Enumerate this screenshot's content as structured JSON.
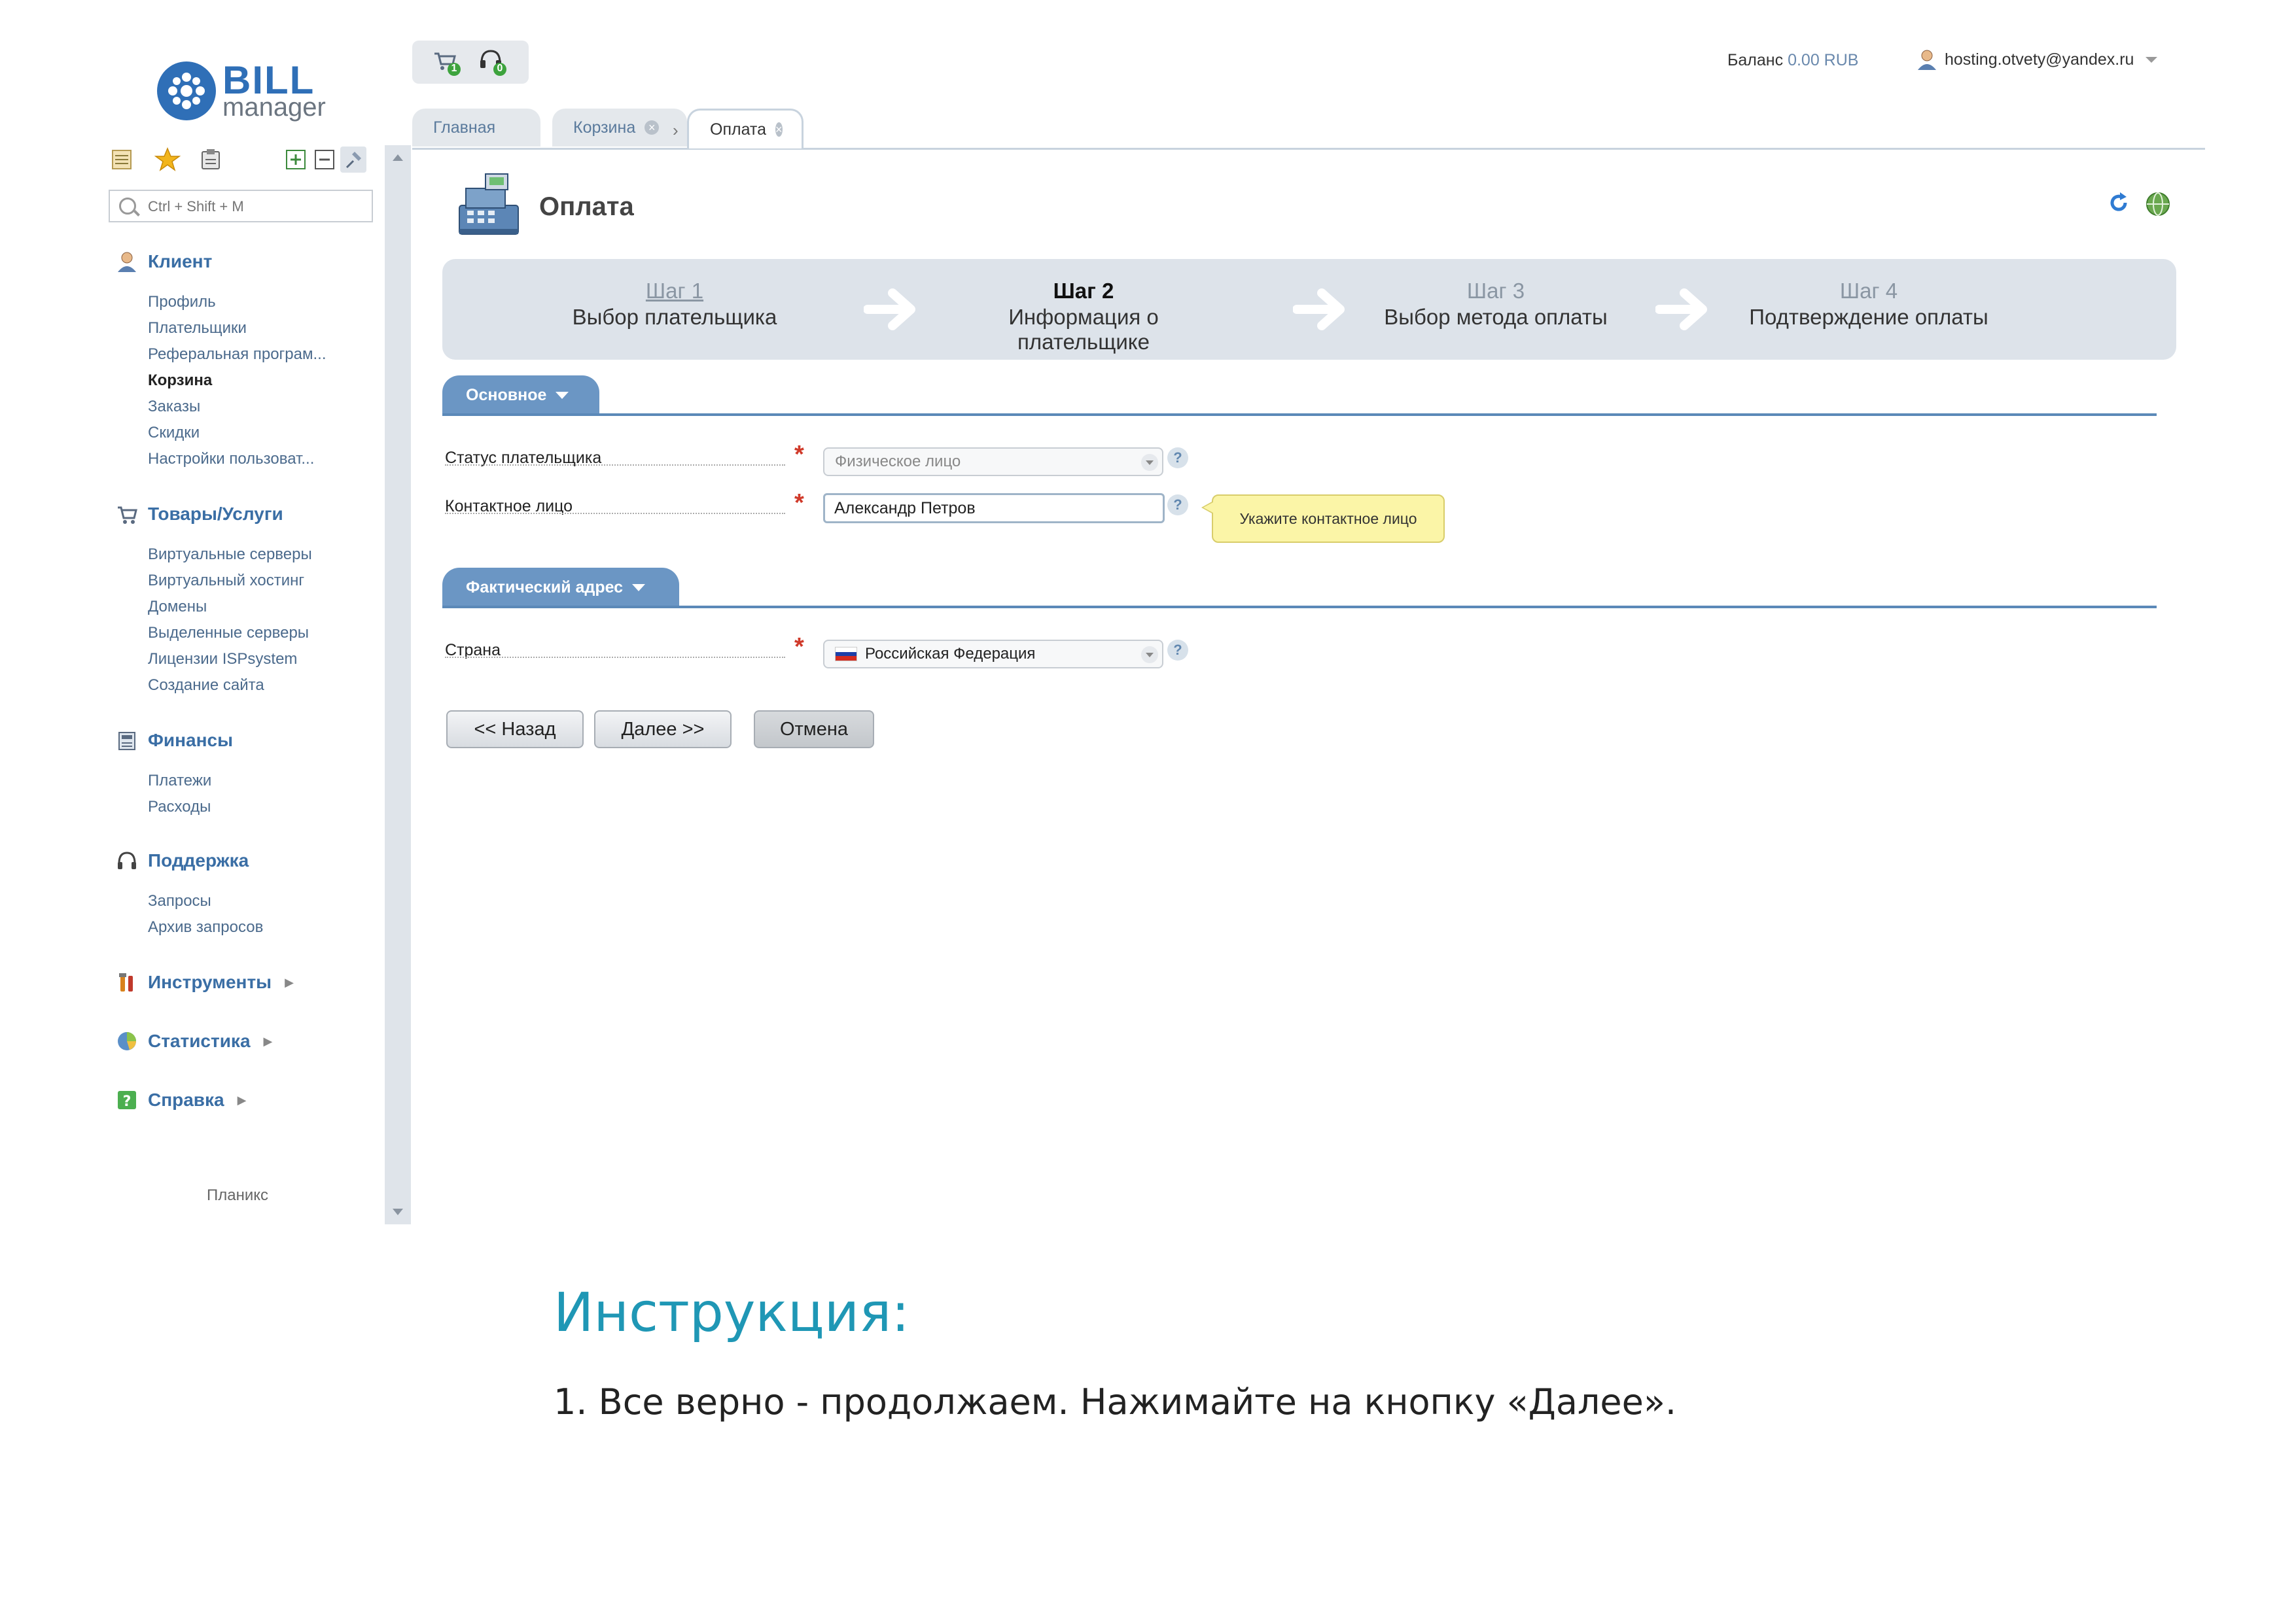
{
  "logo": {
    "word1": "BILL",
    "word2": "manager",
    "brand_color": "#2f6fb7"
  },
  "search": {
    "placeholder": "Ctrl + Shift + M"
  },
  "sidebar": {
    "groups": [
      {
        "title": "Клиент",
        "icon": "user-icon",
        "items": [
          {
            "label": "Профиль"
          },
          {
            "label": "Плательщики"
          },
          {
            "label": "Реферальная програм..."
          },
          {
            "label": "Корзина",
            "active": true
          },
          {
            "label": "Заказы"
          },
          {
            "label": "Скидки"
          },
          {
            "label": "Настройки пользоват..."
          }
        ]
      },
      {
        "title": "Товары/Услуги",
        "icon": "cart-icon",
        "items": [
          {
            "label": "Виртуальные серверы"
          },
          {
            "label": "Виртуальный хостинг"
          },
          {
            "label": "Домены"
          },
          {
            "label": "Выделенные серверы"
          },
          {
            "label": "Лицензии ISPsystem"
          },
          {
            "label": "Создание сайта"
          }
        ]
      },
      {
        "title": "Финансы",
        "icon": "finance-icon",
        "items": [
          {
            "label": "Платежи"
          },
          {
            "label": "Расходы"
          }
        ]
      },
      {
        "title": "Поддержка",
        "icon": "headset-icon",
        "items": [
          {
            "label": "Запросы"
          },
          {
            "label": "Архив запросов"
          }
        ]
      },
      {
        "title": "Инструменты",
        "icon": "tools-icon",
        "items": []
      },
      {
        "title": "Статистика",
        "icon": "pie-chart-icon",
        "items": []
      },
      {
        "title": "Справка",
        "icon": "help-book-icon",
        "items": []
      }
    ],
    "footer": "Планикс"
  },
  "topbar": {
    "balance_label": "Баланс",
    "balance_value": "0.00 RUB",
    "user_email": "hosting.otvety@yandex.ru",
    "cart_badge": "1",
    "support_badge": "0"
  },
  "tabs": [
    {
      "label": "Главная"
    },
    {
      "label": "Корзина"
    },
    {
      "label": "Оплата",
      "active": true
    }
  ],
  "page": {
    "title": "Оплата"
  },
  "steps": [
    {
      "num": "Шаг 1",
      "desc": "Выбор плательщика",
      "state": "done"
    },
    {
      "num": "Шаг 2",
      "desc": "Информация о плательщике",
      "state": "current"
    },
    {
      "num": "Шаг 3",
      "desc": "Выбор метода оплаты",
      "state": "todo"
    },
    {
      "num": "Шаг 4",
      "desc": "Подтверждение оплаты",
      "state": "todo"
    }
  ],
  "sections": {
    "main": {
      "title": "Основное",
      "status_label": "Статус плательщика",
      "status_value": "Физическое лицо",
      "contact_label": "Контактное лицо",
      "contact_value": "Александр Петров",
      "contact_hint": "Укажите контактное лицо"
    },
    "address": {
      "title": "Фактический адрес",
      "country_label": "Страна",
      "country_value": "Российская Федерация"
    }
  },
  "buttons": {
    "back": "<< Назад",
    "next": "Далее >>",
    "cancel": "Отмена"
  },
  "instruction": {
    "title": "Инструкция:",
    "text": "1. Все верно - продолжаем. Нажимайте на кнопку «Далее»."
  },
  "colors": {
    "accent": "#6b96c4",
    "link": "#4b6a8c",
    "required": "#d03a2a",
    "tooltip": "#fbf5a7",
    "instruction_title": "#1f97b5"
  }
}
